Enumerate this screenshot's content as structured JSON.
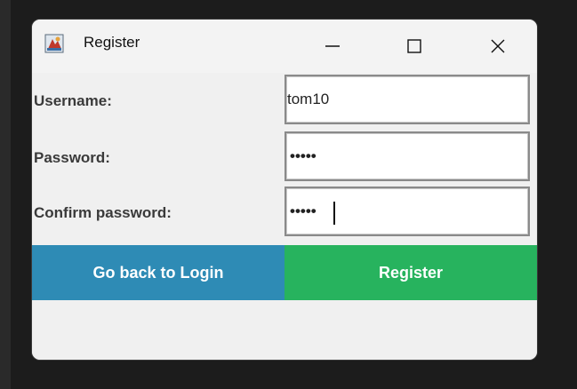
{
  "window": {
    "title": "Register",
    "controls": {
      "minimize": "—",
      "maximize": "☐",
      "close": "✕"
    }
  },
  "form": {
    "username": {
      "label": "Username:",
      "value": "tom10"
    },
    "password": {
      "label": "Password:",
      "masked": "•••••"
    },
    "confirm_password": {
      "label": "Confirm password:",
      "masked": "•••••"
    }
  },
  "buttons": {
    "back_label": "Go back to Login",
    "register_label": "Register"
  },
  "colors": {
    "back_button": "#2e8bb5",
    "register_button": "#27b35e",
    "window_bg": "#f0f0f0"
  }
}
